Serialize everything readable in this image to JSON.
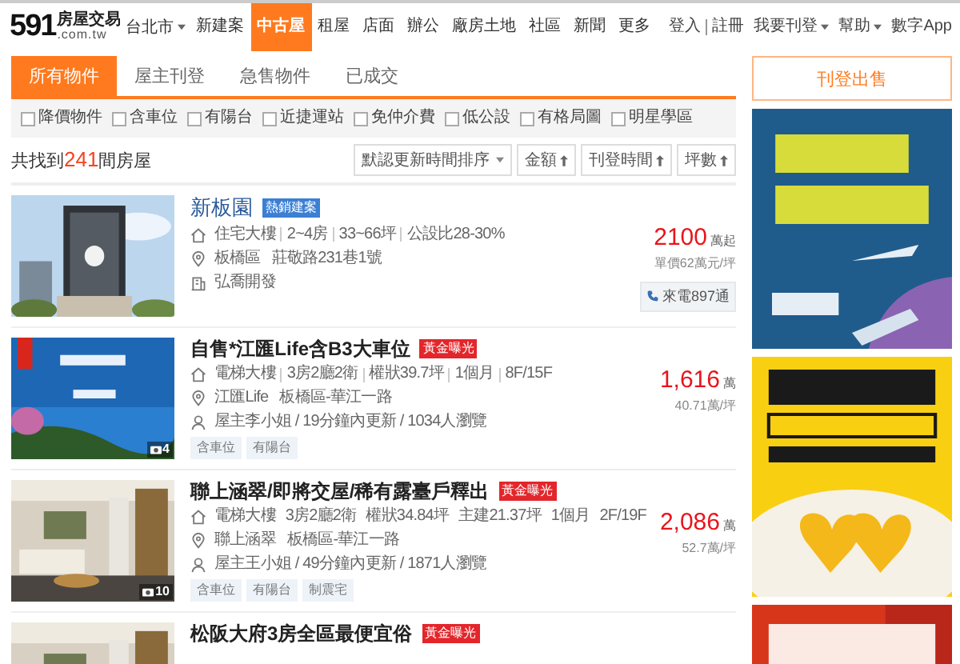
{
  "header": {
    "logo_number": "591",
    "logo_name": "房屋交易",
    "logo_domain": ".com.tw",
    "city": "台北市",
    "nav": [
      {
        "label": "新建案",
        "selected": false
      },
      {
        "label": "中古屋",
        "selected": true
      },
      {
        "label": "租屋",
        "selected": false
      },
      {
        "label": "店面",
        "selected": false
      },
      {
        "label": "辦公",
        "selected": false
      },
      {
        "label": "廠房土地",
        "selected": false
      },
      {
        "label": "社區",
        "selected": false
      },
      {
        "label": "新聞",
        "selected": false
      },
      {
        "label": "更多",
        "selected": false
      }
    ],
    "user_links": [
      {
        "label": "登入",
        "dropdown": false
      },
      {
        "label": "註冊",
        "dropdown": false
      },
      {
        "label": "我要刊登",
        "dropdown": true
      },
      {
        "label": "幫助",
        "dropdown": true
      },
      {
        "label": "數字App",
        "dropdown": false
      }
    ]
  },
  "tabs": [
    {
      "label": "所有物件",
      "selected": true
    },
    {
      "label": "屋主刊登",
      "selected": false
    },
    {
      "label": "急售物件",
      "selected": false
    },
    {
      "label": "已成交",
      "selected": false
    }
  ],
  "filters": [
    {
      "label": "降價物件",
      "checked": false
    },
    {
      "label": "含車位",
      "checked": false
    },
    {
      "label": "有陽台",
      "checked": false
    },
    {
      "label": "近捷運站",
      "checked": false
    },
    {
      "label": "免仲介費",
      "checked": false
    },
    {
      "label": "低公設",
      "checked": false
    },
    {
      "label": "有格局圖",
      "checked": false
    },
    {
      "label": "明星學區",
      "checked": false
    }
  ],
  "result": {
    "prefix": "共找到",
    "count": "241",
    "suffix": "間房屋"
  },
  "sort_buttons": [
    {
      "label": "默認更新時間排序",
      "kind": "dropdown"
    },
    {
      "label": "金額",
      "kind": "sort"
    },
    {
      "label": "刊登時間",
      "kind": "sort"
    },
    {
      "label": "坪數",
      "kind": "sort"
    }
  ],
  "listings": [
    {
      "kind": "project",
      "photo": {
        "kind": "picture"
      },
      "title": "新板園",
      "badge": {
        "label": "熱銷建案",
        "kind": "hot"
      },
      "details": [
        "住宅大樓",
        "2~4房",
        "33~66坪",
        "公設比28-30%"
      ],
      "location": [
        "板橋區",
        "莊敬路231巷1號"
      ],
      "info": {
        "kind": "builder",
        "text": "弘喬開發"
      },
      "price": "2100",
      "price_unit": "萬起",
      "unit_price": "單價62萬元/坪",
      "call": "來電897通"
    },
    {
      "kind": "listing",
      "photo": {
        "kind": "picture"
      },
      "photo_count": "4",
      "title": "自售*江匯Life含B3大車位",
      "badge": {
        "label": "黃金曝光",
        "kind": "gold"
      },
      "details": [
        "電梯大樓",
        "3房2廳2衛",
        "權狀39.7坪",
        "1個月",
        "8F/15F"
      ],
      "location": [
        "江匯Life",
        "板橋區-華江一路"
      ],
      "info": {
        "kind": "owner",
        "text": "屋主李小姐 / 19分鐘內更新 / 1034人瀏覽"
      },
      "tags": [
        "含車位",
        "有陽台"
      ],
      "price": "1,616",
      "price_unit": "萬",
      "unit_price": "40.71萬/坪"
    },
    {
      "kind": "listing",
      "photo": {
        "kind": "picture"
      },
      "photo_count": "10",
      "title": "聯上涵翠/即將交屋/稀有露臺戶釋出",
      "badge": {
        "label": "黃金曝光",
        "kind": "gold"
      },
      "details": [
        "電梯大樓",
        "3房2廳2衛",
        "權狀34.84坪",
        "主建21.37坪",
        "1個月",
        "2F/19F"
      ],
      "location": [
        "聯上涵翠",
        "板橋區-華江一路"
      ],
      "info": {
        "kind": "owner",
        "text": "屋主王小姐 / 49分鐘內更新 / 1871人瀏覽"
      },
      "tags": [
        "含車位",
        "有陽台",
        "制震宅"
      ],
      "price": "2,086",
      "price_unit": "萬",
      "unit_price": "52.7萬/坪"
    },
    {
      "kind": "listing",
      "photo": {
        "kind": "picture"
      },
      "title": "松阪大府3房全區最便宜俗",
      "badge": {
        "label": "黃金曝光",
        "kind": "gold"
      }
    }
  ],
  "sidebar": {
    "post_button": "刊登出售",
    "ads": [
      {
        "kind": "picture"
      },
      {
        "kind": "picture"
      },
      {
        "kind": "picture"
      }
    ]
  }
}
